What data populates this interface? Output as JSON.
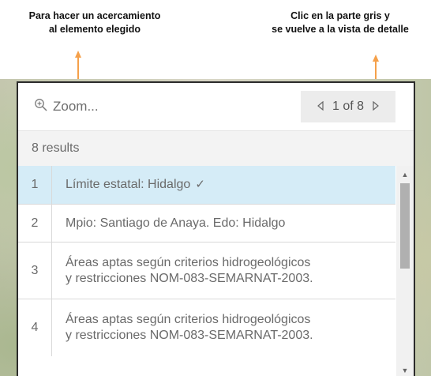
{
  "annotations": {
    "left_line1": "Para hacer un acercamiento",
    "left_line2": "al elemento elegido",
    "right_line1": "Clic en la parte gris y",
    "right_line2": "se vuelve a la vista de detalle"
  },
  "colors": {
    "arrow": "#f5a04a",
    "selected_row": "#d5ecf7",
    "pager_bg": "#ececec"
  },
  "toolbar": {
    "zoom_icon": "zoom-in-icon",
    "zoom_label": "Zoom...",
    "pager": {
      "prev_icon": "caret-left-icon",
      "text": "1 of 8",
      "next_icon": "caret-right-icon"
    }
  },
  "results": {
    "summary": "8 results"
  },
  "list": {
    "items": [
      {
        "index": "1",
        "line1": "Límite estatal: Hidalgo",
        "line2": "",
        "selected": true
      },
      {
        "index": "2",
        "line1": "Mpio: Santiago de Anaya. Edo: Hidalgo",
        "line2": ""
      },
      {
        "index": "3",
        "line1": "Áreas aptas según criterios hidrogeológicos",
        "line2": "y restricciones NOM-083-SEMARNAT-2003."
      },
      {
        "index": "4",
        "line1": "Áreas aptas según criterios hidrogeológicos",
        "line2": "y restricciones NOM-083-SEMARNAT-2003."
      }
    ]
  },
  "scrollbar": {
    "up_icon": "triangle-up-icon",
    "down_icon": "triangle-down-icon"
  }
}
